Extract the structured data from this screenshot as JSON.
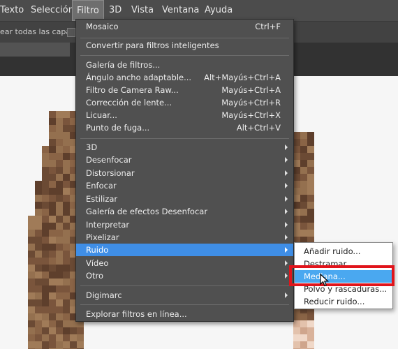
{
  "menubar": {
    "items": [
      {
        "label": "Texto"
      },
      {
        "label": "Selección"
      },
      {
        "label": "Filtro"
      },
      {
        "label": "3D"
      },
      {
        "label": "Vista"
      },
      {
        "label": "Ventana"
      },
      {
        "label": "Ayuda"
      }
    ]
  },
  "options_bar": {
    "sample_all_layers_label": "ear todas las capas"
  },
  "filter_menu": {
    "items": [
      {
        "label": "Mosaico",
        "shortcut": "Ctrl+F"
      },
      {
        "label": "Convertir para filtros inteligentes",
        "shortcut": ""
      },
      {
        "label": "Galería de filtros...",
        "shortcut": ""
      },
      {
        "label": "Ángulo ancho adaptable...",
        "shortcut": "Alt+Mayús+Ctrl+A"
      },
      {
        "label": "Filtro de Camera Raw...",
        "shortcut": "Mayús+Ctrl+A"
      },
      {
        "label": "Corrección de lente...",
        "shortcut": "Mayús+Ctrl+R"
      },
      {
        "label": "Licuar...",
        "shortcut": "Mayús+Ctrl+X"
      },
      {
        "label": "Punto de fuga...",
        "shortcut": "Alt+Ctrl+V"
      },
      {
        "label": "3D",
        "submenu": true
      },
      {
        "label": "Desenfocar",
        "submenu": true
      },
      {
        "label": "Distorsionar",
        "submenu": true
      },
      {
        "label": "Enfocar",
        "submenu": true
      },
      {
        "label": "Estilizar",
        "submenu": true
      },
      {
        "label": "Galería de efectos Desenfocar",
        "submenu": true
      },
      {
        "label": "Interpretar",
        "submenu": true
      },
      {
        "label": "Pixelizar",
        "submenu": true
      },
      {
        "label": "Ruido",
        "submenu": true,
        "highlighted": true
      },
      {
        "label": "Vídeo",
        "submenu": true
      },
      {
        "label": "Otro",
        "submenu": true
      },
      {
        "label": "Digimarc",
        "submenu": true
      },
      {
        "label": "Explorar filtros en línea...",
        "shortcut": ""
      }
    ]
  },
  "noise_submenu": {
    "items": [
      {
        "label": "Añadir ruido..."
      },
      {
        "label": "Destramar"
      },
      {
        "label": "Mediana...",
        "highlighted": true
      },
      {
        "label": "Polvo y rascaduras..."
      },
      {
        "label": "Reducir ruido..."
      }
    ]
  },
  "colors": {
    "menu_highlight": "#3f8ee6",
    "submenu_highlight": "#4aa8f0",
    "annotation_box": "#e0141b"
  }
}
